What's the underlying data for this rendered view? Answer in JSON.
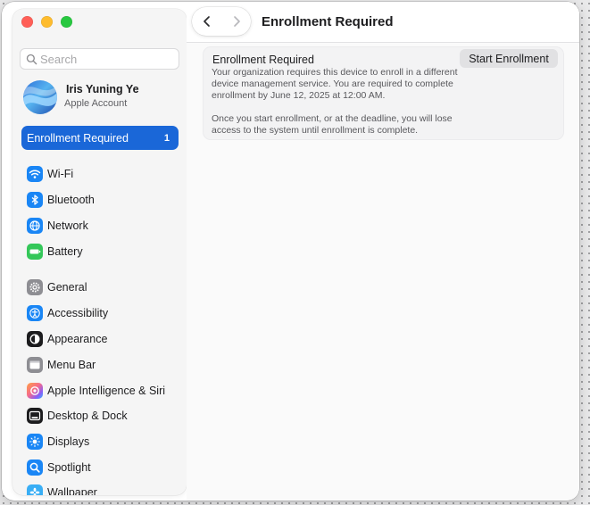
{
  "window": {
    "title": "Enrollment Required"
  },
  "search": {
    "placeholder": "Search"
  },
  "account": {
    "name": "Iris Yuning Ye",
    "subtitle": "Apple Account"
  },
  "enrollment_item": {
    "label": "Enrollment Required",
    "count": "1"
  },
  "sidebar": {
    "items": [
      {
        "label": "Wi-Fi",
        "icon": "wifi-icon",
        "color": "#1a86f5"
      },
      {
        "label": "Bluetooth",
        "icon": "bluetooth-icon",
        "color": "#1a86f5"
      },
      {
        "label": "Network",
        "icon": "globe-icon",
        "color": "#1a86f5"
      },
      {
        "label": "Battery",
        "icon": "battery-icon",
        "color": "#34c759"
      },
      {
        "label": "General",
        "icon": "gear-icon",
        "color": "#8e8e93"
      },
      {
        "label": "Accessibility",
        "icon": "accessibility-icon",
        "color": "#1a86f5"
      },
      {
        "label": "Appearance",
        "icon": "appearance-icon",
        "color": "#1c1c1e"
      },
      {
        "label": "Menu Bar",
        "icon": "menu-bar-icon",
        "color": "#8e8e93"
      },
      {
        "label": "Apple Intelligence & Siri",
        "icon": "siri-icon",
        "color": "#f56b8c"
      },
      {
        "label": "Desktop & Dock",
        "icon": "dock-icon",
        "color": "#1c1c1e"
      },
      {
        "label": "Displays",
        "icon": "sun-icon",
        "color": "#1a86f5"
      },
      {
        "label": "Spotlight",
        "icon": "magnifier-icon",
        "color": "#1a86f5"
      },
      {
        "label": "Wallpaper",
        "icon": "flower-icon",
        "color": "#39aef5"
      }
    ]
  },
  "main": {
    "title": "Enrollment Required",
    "paragraph1": "Your organization requires this device to enroll in a different device management service. You are required to complete enrollment by June 12, 2025 at 12:00 AM.",
    "paragraph2": "Once you start enrollment, or at the deadline, you will lose access to the system until enrollment is complete.",
    "button_label": "Start Enrollment"
  },
  "colors": {
    "accent": "#1a67d8",
    "traffic_red": "#ff5f57",
    "traffic_yellow": "#febc2e",
    "traffic_green": "#28c840"
  }
}
